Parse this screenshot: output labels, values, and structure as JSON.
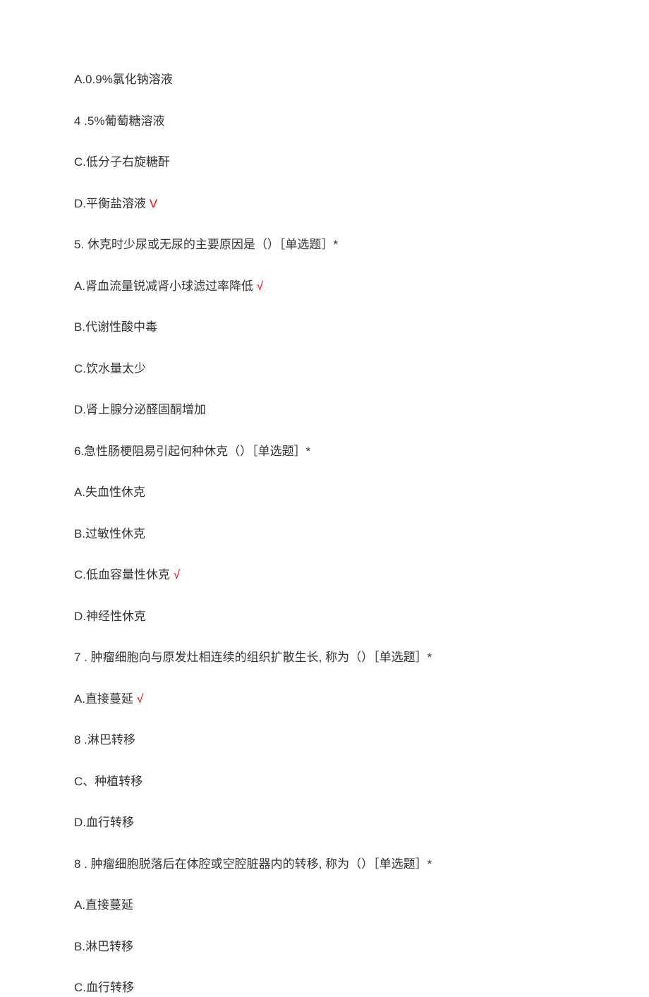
{
  "items": [
    {
      "type": "option",
      "text": "A.0.9%氯化钠溶液"
    },
    {
      "type": "option",
      "text": "4 .5%葡萄糖溶液"
    },
    {
      "type": "option",
      "text": "C.低分子右旋糖酐"
    },
    {
      "type": "option-correct",
      "text": "D.平衡盐溶液",
      "mark": " V"
    },
    {
      "type": "question",
      "text": "5. 休克时少尿或无尿的主要原因是（）［单选题］*"
    },
    {
      "type": "option-correct",
      "text": "A.肾血流量锐减肾小球滤过率降低",
      "mark": " √"
    },
    {
      "type": "option",
      "text": "B.代谢性酸中毒"
    },
    {
      "type": "option",
      "text": "C.饮水量太少"
    },
    {
      "type": "option",
      "text": "D.肾上腺分泌醛固酮增加"
    },
    {
      "type": "question",
      "text": "6.急性肠梗阻易引起何种休克（）［单选题］*"
    },
    {
      "type": "option",
      "text": "A.失血性休克"
    },
    {
      "type": "option",
      "text": "B.过敏性休克"
    },
    {
      "type": "option-correct",
      "text": "C.低血容量性休克",
      "mark": " √"
    },
    {
      "type": "option",
      "text": "D.神经性休克"
    },
    {
      "type": "question",
      "text": "7 . 肿瘤细胞向与原发灶相连续的组织扩散生长, 称为（）［单选题］*"
    },
    {
      "type": "option-correct",
      "text": "A.直接蔓延",
      "mark": " √"
    },
    {
      "type": "option",
      "text": "8 .淋巴转移"
    },
    {
      "type": "option",
      "text": "C、种植转移"
    },
    {
      "type": "option",
      "text": "D.血行转移"
    },
    {
      "type": "question",
      "text": "8 . 肿瘤细胞脱落后在体腔或空腔脏器内的转移, 称为（）［单选题］*"
    },
    {
      "type": "option",
      "text": "A.直接蔓延"
    },
    {
      "type": "option",
      "text": "B.淋巴转移"
    },
    {
      "type": "option",
      "text": "C.血行转移"
    }
  ]
}
